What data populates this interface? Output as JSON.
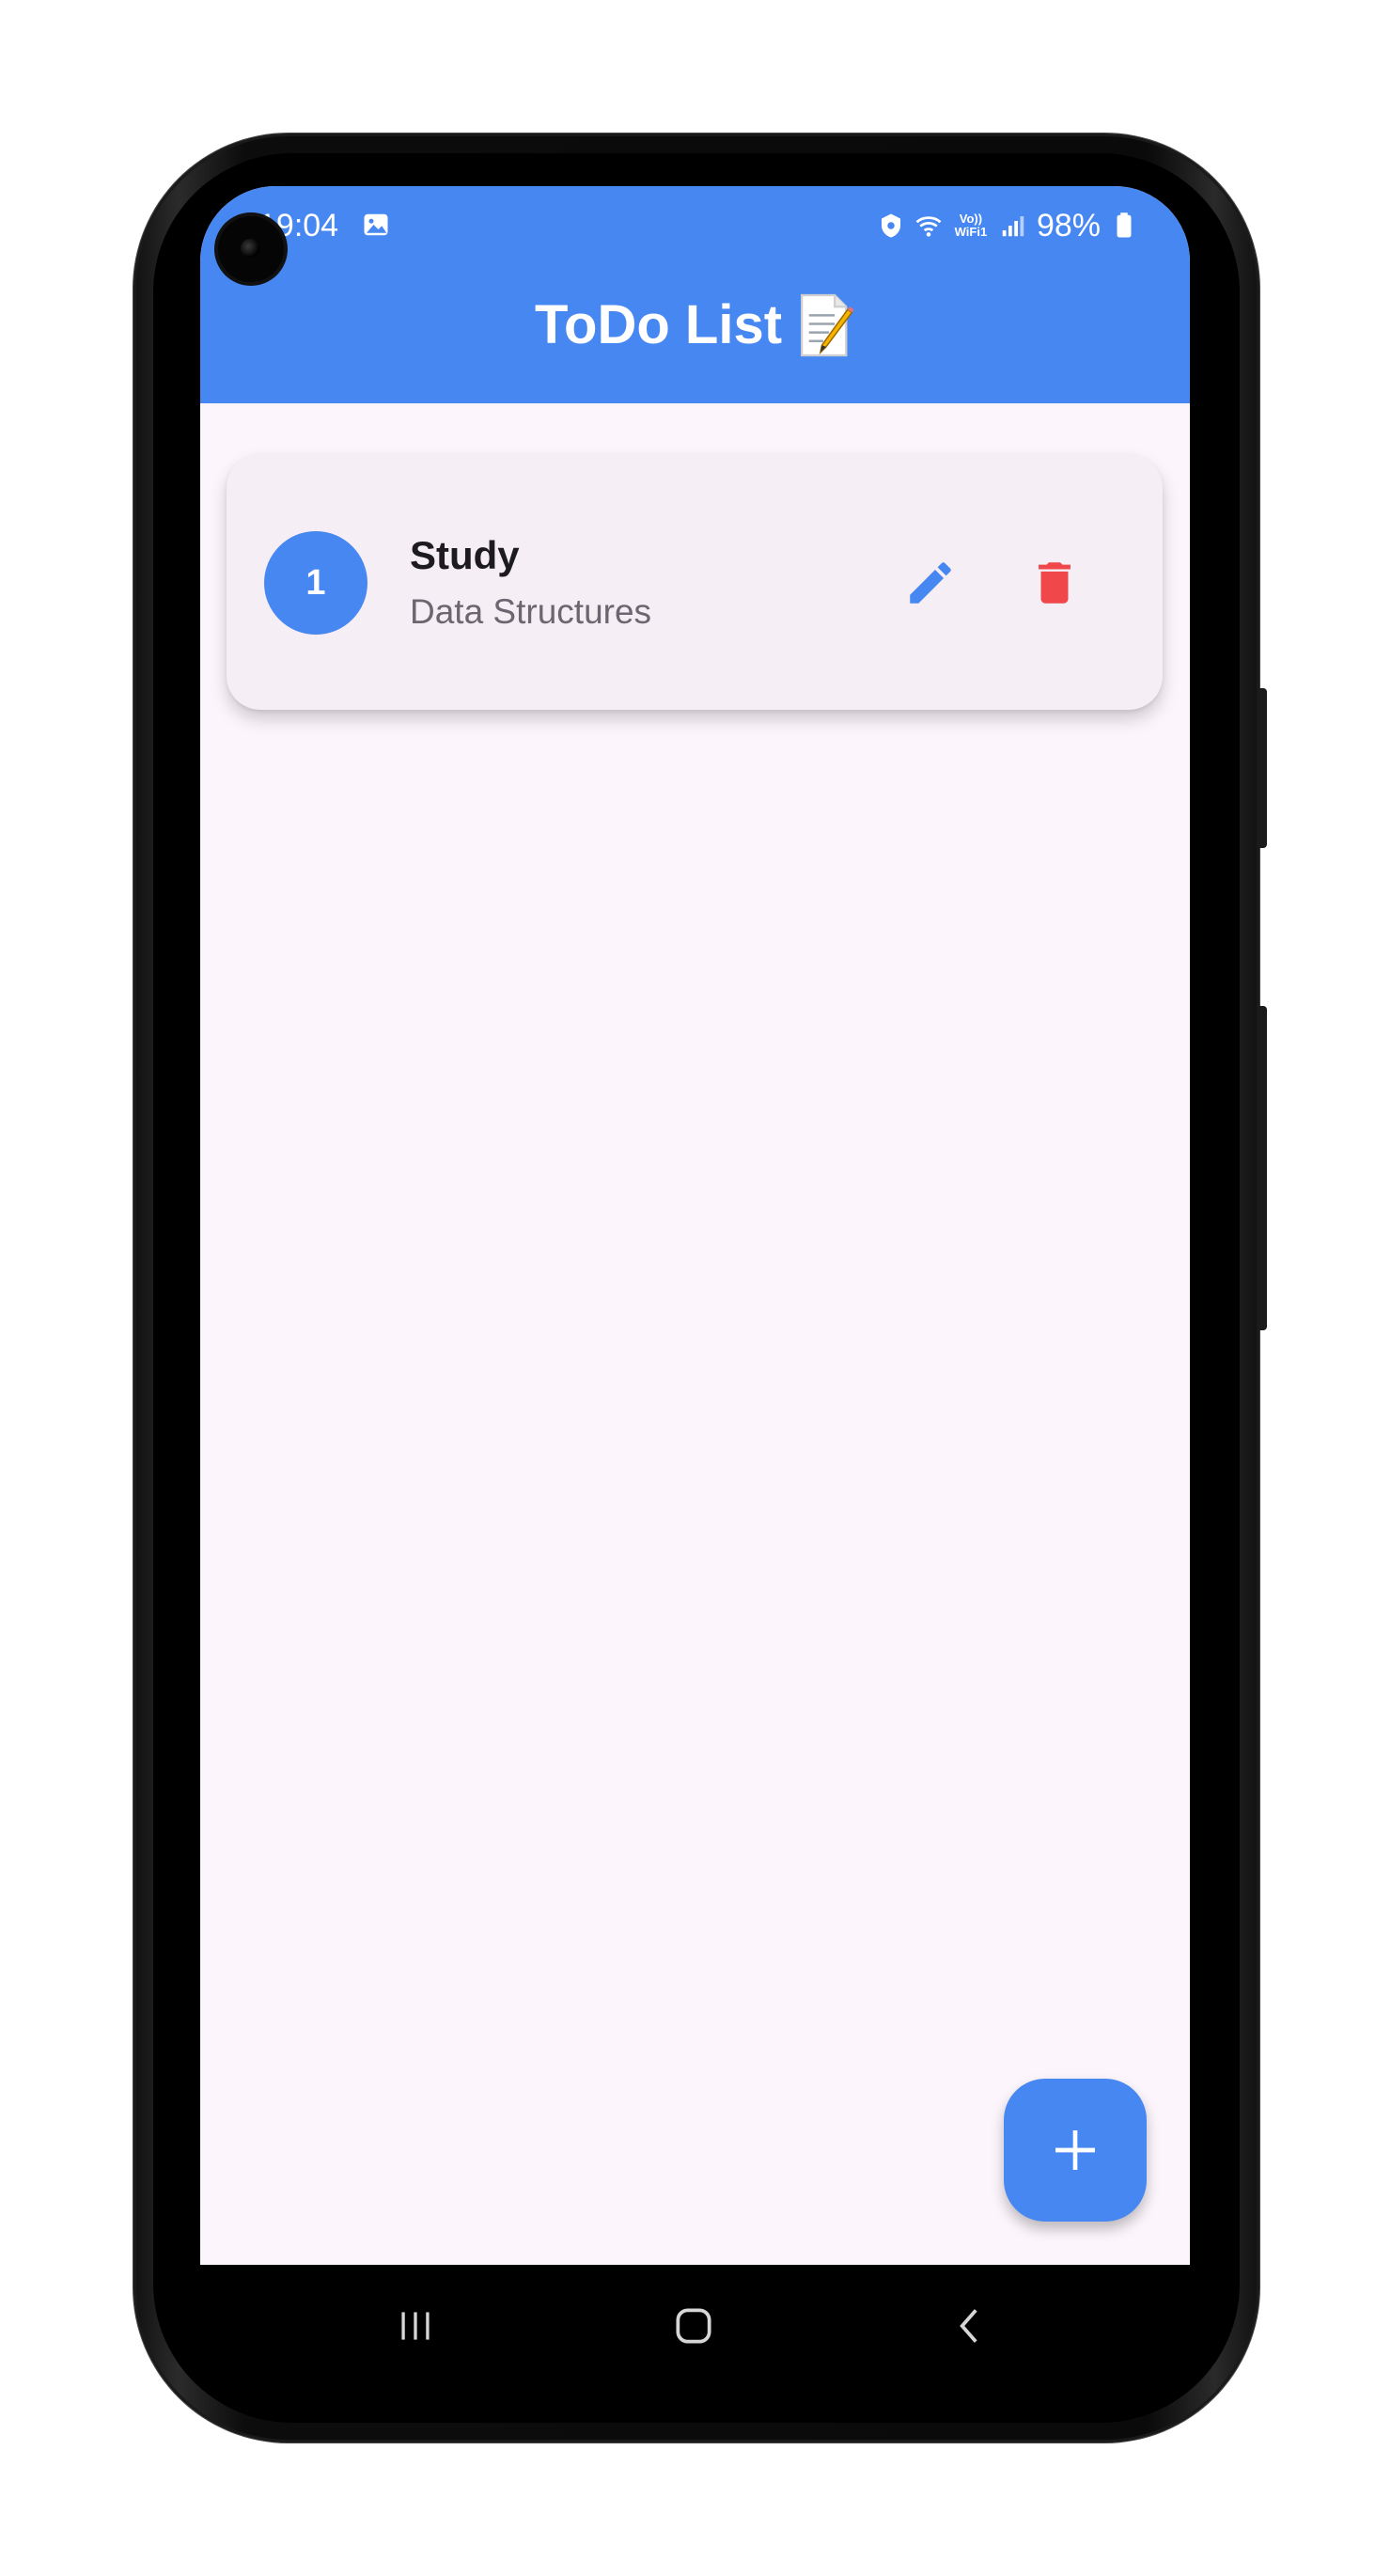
{
  "status_bar": {
    "time": "19:04",
    "network_label_top": "Vo))",
    "network_label_bottom": "WiFi1",
    "battery_percent": "98%"
  },
  "app_bar": {
    "title": "ToDo List",
    "background_color": "#4787f2"
  },
  "tasks": [
    {
      "number": "1",
      "title": "Study",
      "description": "Data Structures"
    }
  ],
  "icons": {
    "edit": "pencil-icon",
    "delete": "trash-icon",
    "add": "plus-icon",
    "title_emoji": "memo-icon"
  },
  "colors": {
    "accent": "#4787f2",
    "delete": "#f0474b",
    "background": "#fcf6fc",
    "card": "#f5eff5"
  }
}
